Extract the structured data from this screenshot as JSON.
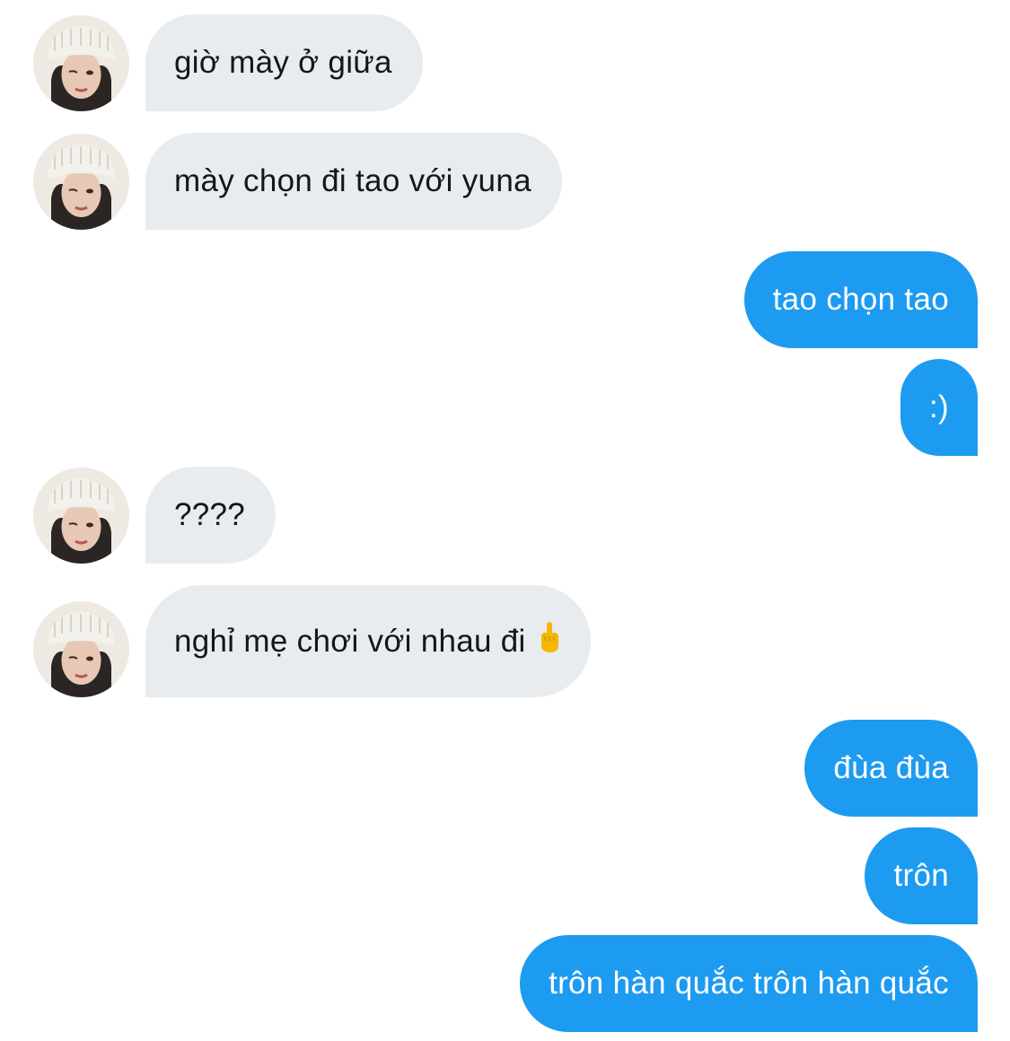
{
  "contact": {
    "avatar_icon": "profile-photo-beanie-icon"
  },
  "colors": {
    "incoming_bubble": "#e8ecef",
    "outgoing_bubble": "#1d9bf0",
    "incoming_text": "#14171a",
    "outgoing_text": "#ffffff"
  },
  "messages": [
    {
      "direction": "incoming",
      "text": "giờ mày ở giữa"
    },
    {
      "direction": "incoming",
      "text": "mày chọn đi tao với yuna"
    },
    {
      "direction": "outgoing",
      "text": "tao chọn tao"
    },
    {
      "direction": "outgoing",
      "text": ":)"
    },
    {
      "direction": "incoming",
      "text": "????"
    },
    {
      "direction": "incoming",
      "text": "nghỉ mẹ chơi với nhau đi",
      "emoji": "middle-finger-emoji"
    },
    {
      "direction": "outgoing",
      "text": "đùa đùa"
    },
    {
      "direction": "outgoing",
      "text": "trôn"
    },
    {
      "direction": "outgoing",
      "text": "trôn hàn quắc trôn hàn quắc"
    }
  ]
}
